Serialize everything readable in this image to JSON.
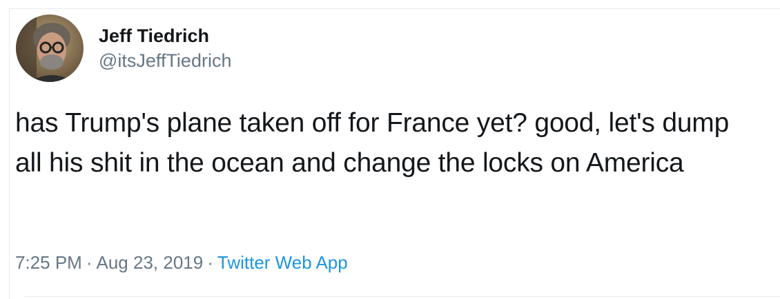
{
  "tweet": {
    "display_name": "Jeff Tiedrich",
    "handle": "@itsJeffTiedrich",
    "avatar_icon": "user-avatar-photo",
    "text": "has Trump's plane taken off for France yet? good, let's dump all his shit in the ocean and change the locks on America",
    "time": "7:25 PM",
    "separator": "·",
    "date": "Aug 23, 2019",
    "source": "Twitter Web App"
  },
  "colors": {
    "text_primary": "#14171a",
    "text_secondary": "#657786",
    "link": "#1b95e0",
    "border": "#e6ecf0"
  }
}
